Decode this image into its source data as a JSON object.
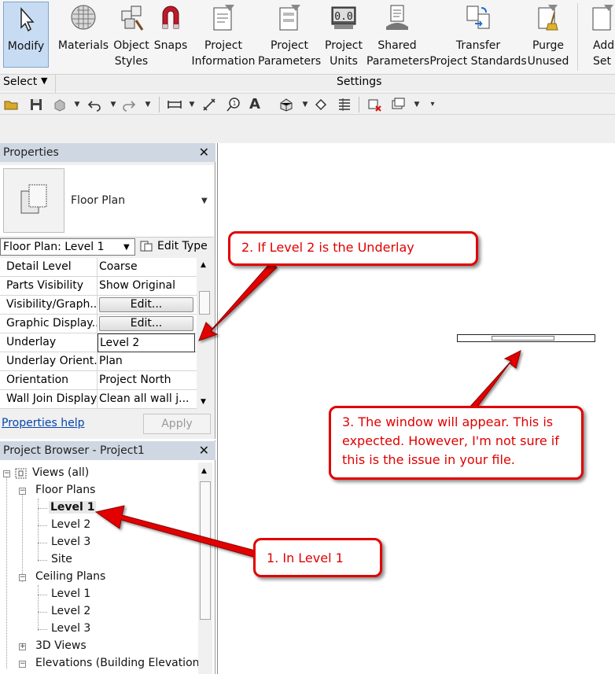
{
  "ribbon": {
    "buttons": [
      {
        "label": "Modify",
        "icon": "cursor-arrow-icon"
      },
      {
        "label": "Materials",
        "icon": "materials-sphere-icon"
      },
      {
        "label": "Object\nStyles",
        "icon": "object-styles-icon"
      },
      {
        "label": "Snaps",
        "icon": "magnet-icon"
      },
      {
        "label": "Project\nInformation",
        "icon": "project-information-icon"
      },
      {
        "label": "Project\nParameters",
        "icon": "project-parameters-icon"
      },
      {
        "label": "Project\nUnits",
        "icon": "project-units-icon"
      },
      {
        "label": "Shared\nParameters",
        "icon": "shared-parameters-icon"
      },
      {
        "label": "Transfer\nProject Standards",
        "icon": "transfer-standards-icon"
      },
      {
        "label": "Purge\nUnused",
        "icon": "purge-broom-icon"
      },
      {
        "label": "Addi\nSet",
        "icon": "additional-settings-icon"
      }
    ],
    "select_label": "Select",
    "settings_label": "Settings",
    "units_icon_text": "0.0"
  },
  "properties": {
    "title": "Properties",
    "type_name": "Floor Plan",
    "instance_selector": "Floor Plan: Level 1",
    "edit_type_label": "Edit Type",
    "rows": [
      {
        "name": "Detail Level",
        "value": "Coarse"
      },
      {
        "name": "Parts Visibility",
        "value": "Show Original"
      },
      {
        "name": "Visibility/Graph...",
        "value": "Edit..."
      },
      {
        "name": "Graphic Display...",
        "value": "Edit..."
      },
      {
        "name": "Underlay",
        "value": "Level 2"
      },
      {
        "name": "Underlay Orient...",
        "value": "Plan"
      },
      {
        "name": "Orientation",
        "value": "Project North"
      },
      {
        "name": "Wall Join Display",
        "value": "Clean all wall j..."
      }
    ],
    "help_link": "Properties help",
    "apply_label": "Apply"
  },
  "browser": {
    "title": "Project Browser - Project1",
    "root": "Views (all)",
    "floor_plans": "Floor Plans",
    "floor_items": [
      "Level 1",
      "Level 2",
      "Level 3",
      "Site"
    ],
    "ceiling_plans": "Ceiling Plans",
    "ceiling_items": [
      "Level 1",
      "Level 2",
      "Level 3"
    ],
    "views_3d": "3D Views",
    "elevations": "Elevations (Building Elevation"
  },
  "callouts": {
    "c1": "1. In Level 1",
    "c2": "2. If Level 2 is the Underlay",
    "c3": "3. The window will appear. This is expected. However, I'm not sure if this is the issue in your file."
  },
  "colors": {
    "callout_red": "#e20000",
    "selection_blue": "#c7dcf3",
    "panel_title": "#cfd8e2"
  }
}
